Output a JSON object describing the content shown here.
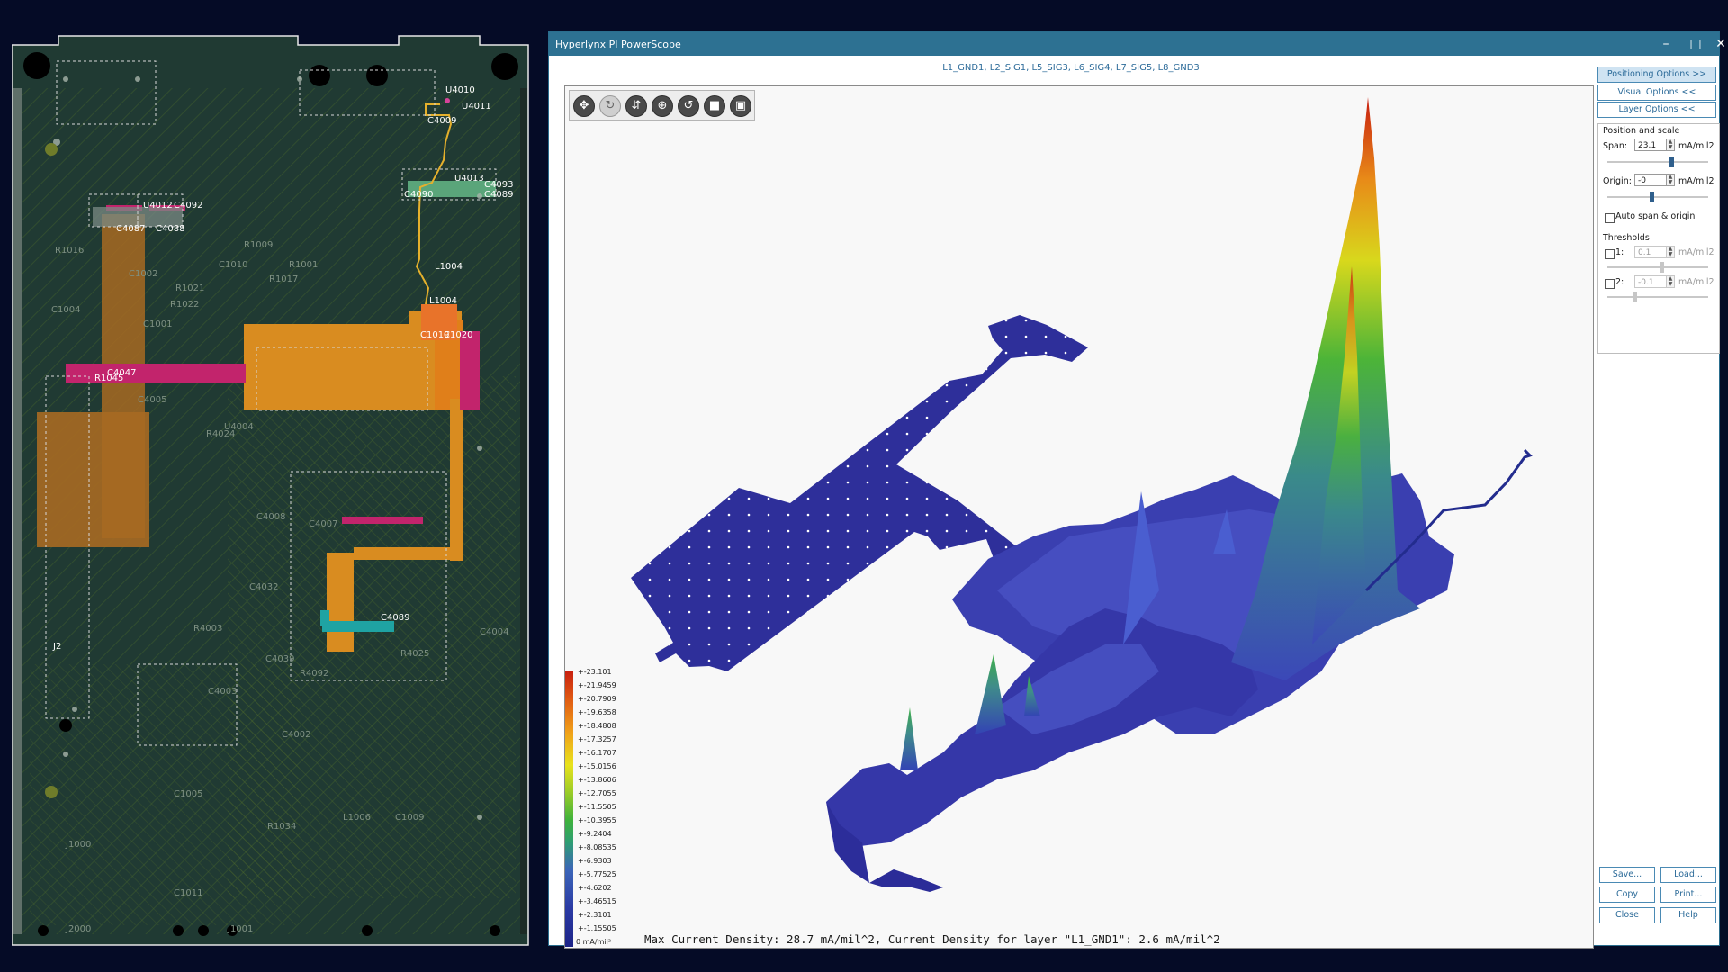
{
  "pcb": {
    "labels": [
      "U4010",
      "U4011",
      "C4009",
      "U4013",
      "C4093",
      "C4089",
      "C4090",
      "C4092",
      "U4012",
      "C4087",
      "C4088",
      "L1004",
      "L1004",
      "C1019",
      "C1020",
      "R1045",
      "C4047",
      "C4005",
      "U4004",
      "C4008",
      "R4025",
      "C4032",
      "R4003",
      "J2",
      "J1000",
      "J2000",
      "J1001",
      "C4089",
      "C4004"
    ],
    "dim_labels": [
      "R4024",
      "R1001",
      "R1016",
      "C1004",
      "R1009",
      "C1010",
      "R1017",
      "R1021",
      "C1002",
      "R1022",
      "C1001",
      "C4007",
      "C4003",
      "C4002",
      "R4092",
      "C4039",
      "C1005",
      "R1034",
      "C1009",
      "L1006",
      "C1011"
    ]
  },
  "window": {
    "title": "Hyperlynx PI PowerScope",
    "minimize_icon": "minimize-icon",
    "maximize_icon": "maximize-icon",
    "close_icon": "close-icon",
    "layers": "L1_GND1, L2_SIG1, L5_SIG3, L6_SIG4, L7_SIG5, L8_GND3"
  },
  "toolbar": [
    "pan-icon",
    "rotate-icon",
    "zoom-icon",
    "target-icon",
    "refresh-icon",
    "stop-icon",
    "fit-icon"
  ],
  "legend": {
    "values": [
      "+-23.101",
      "+-21.9459",
      "+-20.7909",
      "+-19.6358",
      "+-18.4808",
      "+-17.3257",
      "+-16.1707",
      "+-15.0156",
      "+-13.8606",
      "+-12.7055",
      "+-11.5505",
      "+-10.3955",
      "+-9.2404",
      "+-8.08535",
      "+-6.9303",
      "+-5.77525",
      "+-4.6202",
      "+-3.46515",
      "+-2.3101",
      "+-1.15505",
      "0 mA/mil²"
    ]
  },
  "status": "Max Current Density: 28.7 mA/mil^2, Current Density for layer \"L1_GND1\": 2.6 mA/mil^2",
  "options": {
    "positioning_label": "Positioning Options >>",
    "visual_label": "Visual Options <<",
    "layer_label": "Layer Options <<",
    "position_scale_header": "Position and scale",
    "span_label": "Span:",
    "span_value": "23.1",
    "span_unit": "mA/mil2",
    "span_slider": 0.62,
    "origin_label": "Origin:",
    "origin_value": "-0",
    "origin_unit": "mA/mil2",
    "origin_slider": 0.42,
    "auto_label": "Auto span & origin",
    "thresholds_header": "Thresholds",
    "t1_label": "1:",
    "t1_value": "0.1",
    "t1_unit": "mA/mil2",
    "t2_label": "2:",
    "t2_value": "-0.1",
    "t2_unit": "mA/mil2"
  },
  "buttons": {
    "save": "Save...",
    "load": "Load...",
    "copy": "Copy",
    "print": "Print...",
    "close": "Close",
    "help": "Help"
  }
}
